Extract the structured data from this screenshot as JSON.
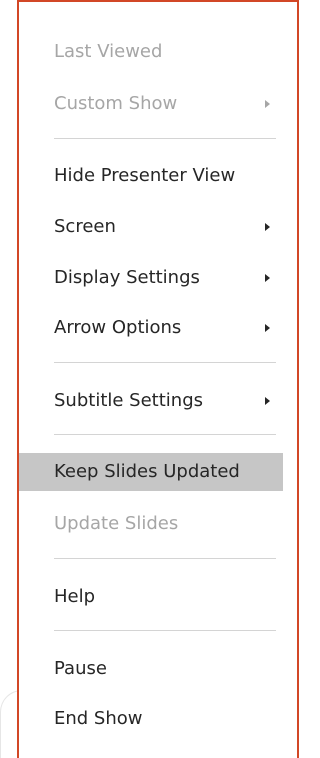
{
  "menu": {
    "items": [
      {
        "label": "Last Viewed",
        "disabled": true,
        "submenu": false
      },
      {
        "label": "Custom Show",
        "disabled": true,
        "submenu": true
      },
      {
        "label": "Hide Presenter View",
        "disabled": false,
        "submenu": false
      },
      {
        "label": "Screen",
        "disabled": false,
        "submenu": true
      },
      {
        "label": "Display Settings",
        "disabled": false,
        "submenu": true
      },
      {
        "label": "Arrow Options",
        "disabled": false,
        "submenu": true
      },
      {
        "label": "Subtitle Settings",
        "disabled": false,
        "submenu": true
      },
      {
        "label": "Keep Slides Updated",
        "disabled": false,
        "submenu": false,
        "highlighted": true
      },
      {
        "label": "Update Slides",
        "disabled": true,
        "submenu": false
      },
      {
        "label": "Help",
        "disabled": false,
        "submenu": false
      },
      {
        "label": "Pause",
        "disabled": false,
        "submenu": false
      },
      {
        "label": "End Show",
        "disabled": false,
        "submenu": false
      }
    ]
  },
  "colors": {
    "accent_border": "#d24726",
    "text": "#262626",
    "disabled_text": "#a6a6a6",
    "highlight": "#c6c6c6",
    "separator": "#d4d4d4"
  },
  "icons": {
    "submenu": "chevron-right-icon"
  }
}
